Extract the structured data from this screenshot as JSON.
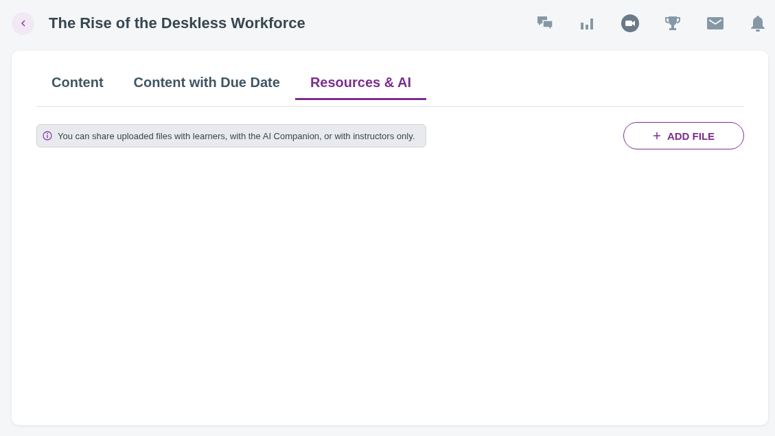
{
  "header": {
    "title": "The Rise of the Deskless Workforce"
  },
  "tabs": [
    {
      "label": "Content",
      "selected": false
    },
    {
      "label": "Content with Due Date",
      "selected": false
    },
    {
      "label": "Resources & AI",
      "selected": true
    }
  ],
  "info_banner": {
    "text": "You can share uploaded files with learners, with the AI Companion, or with instructors only."
  },
  "add_file_button": {
    "label": "ADD FILE"
  }
}
